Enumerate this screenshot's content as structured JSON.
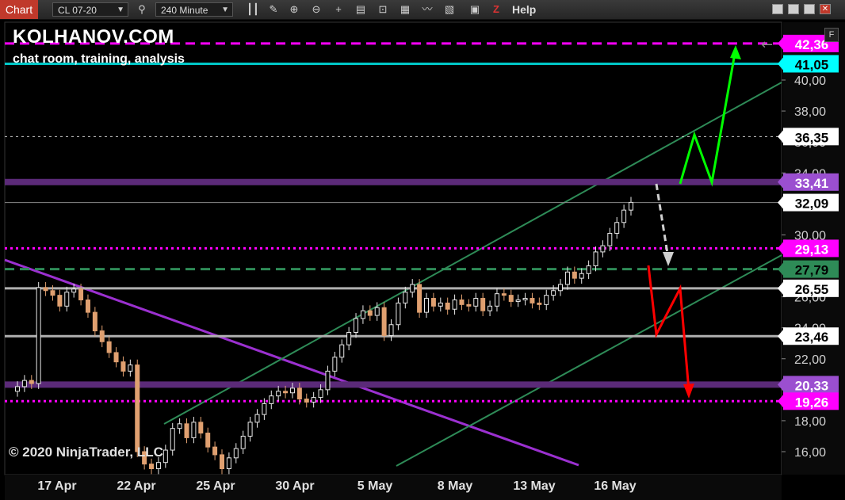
{
  "toolbar": {
    "chart_tab": "Chart",
    "instrument": "CL 07-20",
    "period": "240 Minute",
    "help": "Help",
    "icons": [
      "search-icon",
      "bar-style-icon",
      "draw-icon",
      "zoom-in-icon",
      "zoom-out-icon",
      "crosshair-icon",
      "data-box-icon",
      "indicators-icon",
      "strategies-icon",
      "templates-icon",
      "properties-icon",
      "snapshot-icon",
      "ninjascript-icon"
    ]
  },
  "overlay": {
    "brand": "KOLHANOV.COM",
    "tagline": "chat room, training, analysis",
    "copyright": "© 2020 NinjaTrader, LLC",
    "f_button": "F"
  },
  "colors": {
    "magenta": "#ff00ff",
    "cyan": "#00d0d0",
    "purple_zone": "#6a2c8a",
    "grey_line": "#c0c0c0",
    "green_dash": "#2e8b57",
    "channel": "#2e8b57",
    "downtrend": "#9b30d0",
    "arrow_up": "#00ff00",
    "arrow_down": "#ff0000",
    "candle_up": "#e8e8e8",
    "candle_down": "#e0a070"
  },
  "chart_data": {
    "type": "candlestick",
    "symbol": "CL 07-20",
    "interval": "240 Minute",
    "ylim": [
      14.8,
      43.4
    ],
    "y_ticks": [
      "16,00",
      "18,00",
      "20,00",
      "22,00",
      "24,00",
      "26,00",
      "28,00",
      "30,00",
      "32,00",
      "34,00",
      "36,00",
      "38,00",
      "40,00"
    ],
    "x_ticks": [
      "17 Apr",
      "22 Apr",
      "25 Apr",
      "30 Apr",
      "5 May",
      "8 May",
      "13 May",
      "16 May"
    ],
    "levels": [
      {
        "price": 42.36,
        "label": "42,36",
        "style": "dash",
        "color": "#ff00ff",
        "label_bg": "#ff00ff",
        "label_fg": "#ffffff"
      },
      {
        "price": 41.05,
        "label": "41,05",
        "style": "solid",
        "color": "#00c8c8",
        "label_bg": "#00ffff",
        "label_fg": "#000000"
      },
      {
        "price": 36.35,
        "label": "36,35",
        "style": "dotted",
        "color": "#cccccc",
        "label_bg": "#ffffff",
        "label_fg": "#000000"
      },
      {
        "price": 33.41,
        "label": "33,41",
        "style": "zone",
        "color": "#5b2a78",
        "label_bg": "#9b4fd0",
        "label_fg": "#ffffff"
      },
      {
        "price": 32.09,
        "label": "32,09",
        "style": "thin",
        "color": "#888888",
        "label_bg": "#ffffff",
        "label_fg": "#000000"
      },
      {
        "price": 29.13,
        "label": "29,13",
        "style": "dotted",
        "color": "#ff00ff",
        "label_bg": "#ff00ff",
        "label_fg": "#ffffff"
      },
      {
        "price": 27.79,
        "label": "27,79",
        "style": "dash",
        "color": "#2e8b57",
        "label_bg": "#2e8b57",
        "label_fg": "#000000"
      },
      {
        "price": 26.55,
        "label": "26,55",
        "style": "solid",
        "color": "#b0b0b0",
        "label_bg": "#ffffff",
        "label_fg": "#000000"
      },
      {
        "price": 23.46,
        "label": "23,46",
        "style": "solid",
        "color": "#b0b0b0",
        "label_bg": "#ffffff",
        "label_fg": "#000000"
      },
      {
        "price": 20.33,
        "label": "20,33",
        "style": "zone",
        "color": "#5b2a78",
        "label_bg": "#9b4fd0",
        "label_fg": "#ffffff"
      },
      {
        "price": 19.26,
        "label": "19,26",
        "style": "dotted",
        "color": "#ff00ff",
        "label_bg": "#ff00ff",
        "label_fg": "#ffffff"
      }
    ],
    "close_series": [
      20.2,
      20.6,
      20.4,
      26.6,
      26.4,
      26.1,
      25.4,
      26.3,
      26.5,
      25.8,
      25.0,
      23.8,
      23.1,
      22.4,
      21.8,
      21.2,
      21.6,
      16.0,
      15.2,
      14.9,
      15.3,
      16.1,
      17.5,
      17.8,
      16.9,
      17.9,
      17.2,
      16.3,
      15.8,
      14.9,
      15.6,
      16.2,
      17.0,
      17.9,
      18.4,
      19.1,
      19.6,
      19.9,
      19.8,
      20.1,
      19.4,
      19.2,
      19.5,
      20.0,
      21.2,
      22.1,
      22.9,
      23.7,
      24.6,
      25.1,
      24.8,
      25.3,
      23.5,
      24.2,
      25.6,
      26.3,
      26.8,
      25.0,
      25.9,
      25.4,
      25.6,
      25.2,
      25.8,
      25.5,
      25.4,
      25.9,
      25.1,
      25.4,
      26.2,
      26.1,
      25.7,
      25.8,
      25.9,
      25.6,
      25.5,
      26.1,
      26.4,
      26.8,
      27.6,
      27.2,
      27.5,
      28.0,
      28.9,
      29.3,
      30.1,
      30.8,
      31.6,
      32.1
    ]
  }
}
